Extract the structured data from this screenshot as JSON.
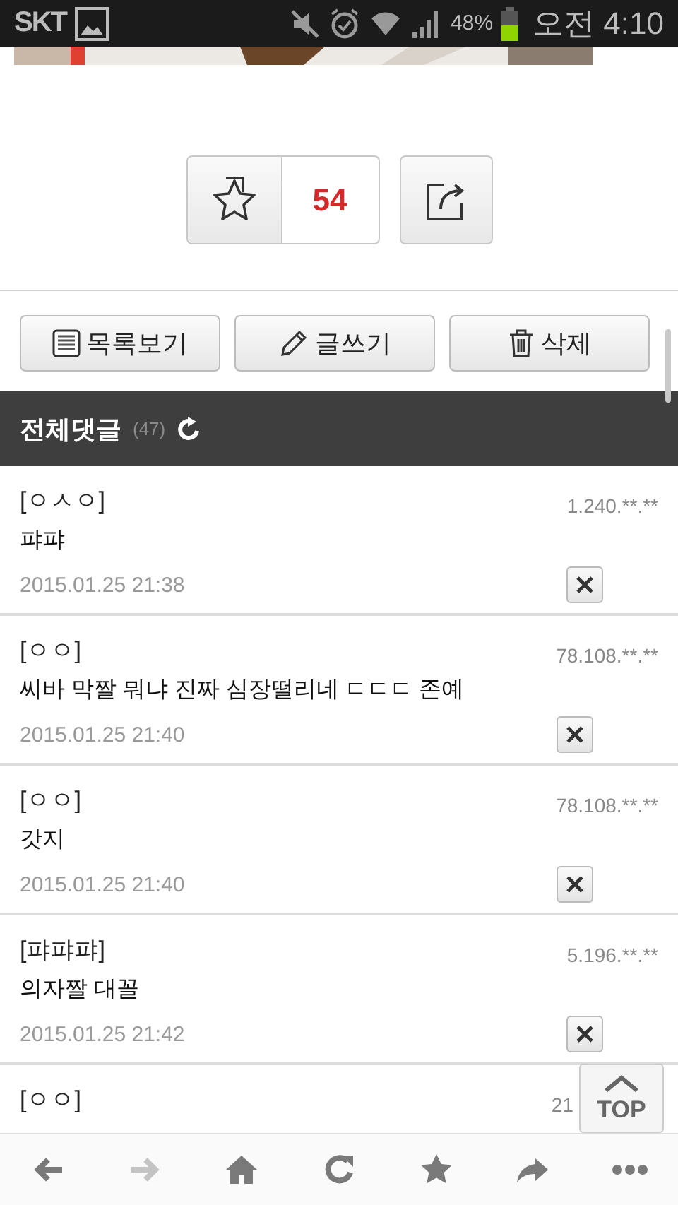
{
  "status_bar": {
    "carrier": "SKT",
    "battery_text": "48%",
    "time": "오전 4:10"
  },
  "vote": {
    "count": "54"
  },
  "actions": [
    {
      "kind": "list",
      "label": "목록보기"
    },
    {
      "kind": "write",
      "label": "글쓰기"
    },
    {
      "kind": "delete",
      "label": "삭제"
    }
  ],
  "comments_header": {
    "title": "전체댓글",
    "count": "(47)"
  },
  "comments": [
    {
      "author": "[ㅇㅅㅇ]",
      "ip": "1.240.**.**",
      "text": "퍄퍄",
      "date": "2015.01.25 21:38"
    },
    {
      "author": "[ㅇㅇ]",
      "ip": "78.108.**.**",
      "text": "씨바 막짤 뭐냐 진짜 심장떨리네 ㄷㄷㄷ 존예",
      "date": "2015.01.25 21:40"
    },
    {
      "author": "[ㅇㅇ]",
      "ip": "78.108.**.**",
      "text": "갓지",
      "date": "2015.01.25 21:40"
    },
    {
      "author": "[퍄퍄퍄]",
      "ip": "5.196.**.**",
      "text": "의자짤 대꼴",
      "date": "2015.01.25 21:42"
    },
    {
      "author": "[ㅇㅇ]",
      "ip": "21"
    }
  ],
  "top_button": {
    "label": "TOP"
  },
  "browser_toolbar": [
    {
      "kind": "back",
      "disabled": false
    },
    {
      "kind": "forward",
      "disabled": true
    },
    {
      "kind": "home",
      "disabled": false
    },
    {
      "kind": "reload",
      "disabled": false
    },
    {
      "kind": "bookmark",
      "disabled": false
    },
    {
      "kind": "share",
      "disabled": false
    },
    {
      "kind": "more",
      "disabled": false
    }
  ]
}
